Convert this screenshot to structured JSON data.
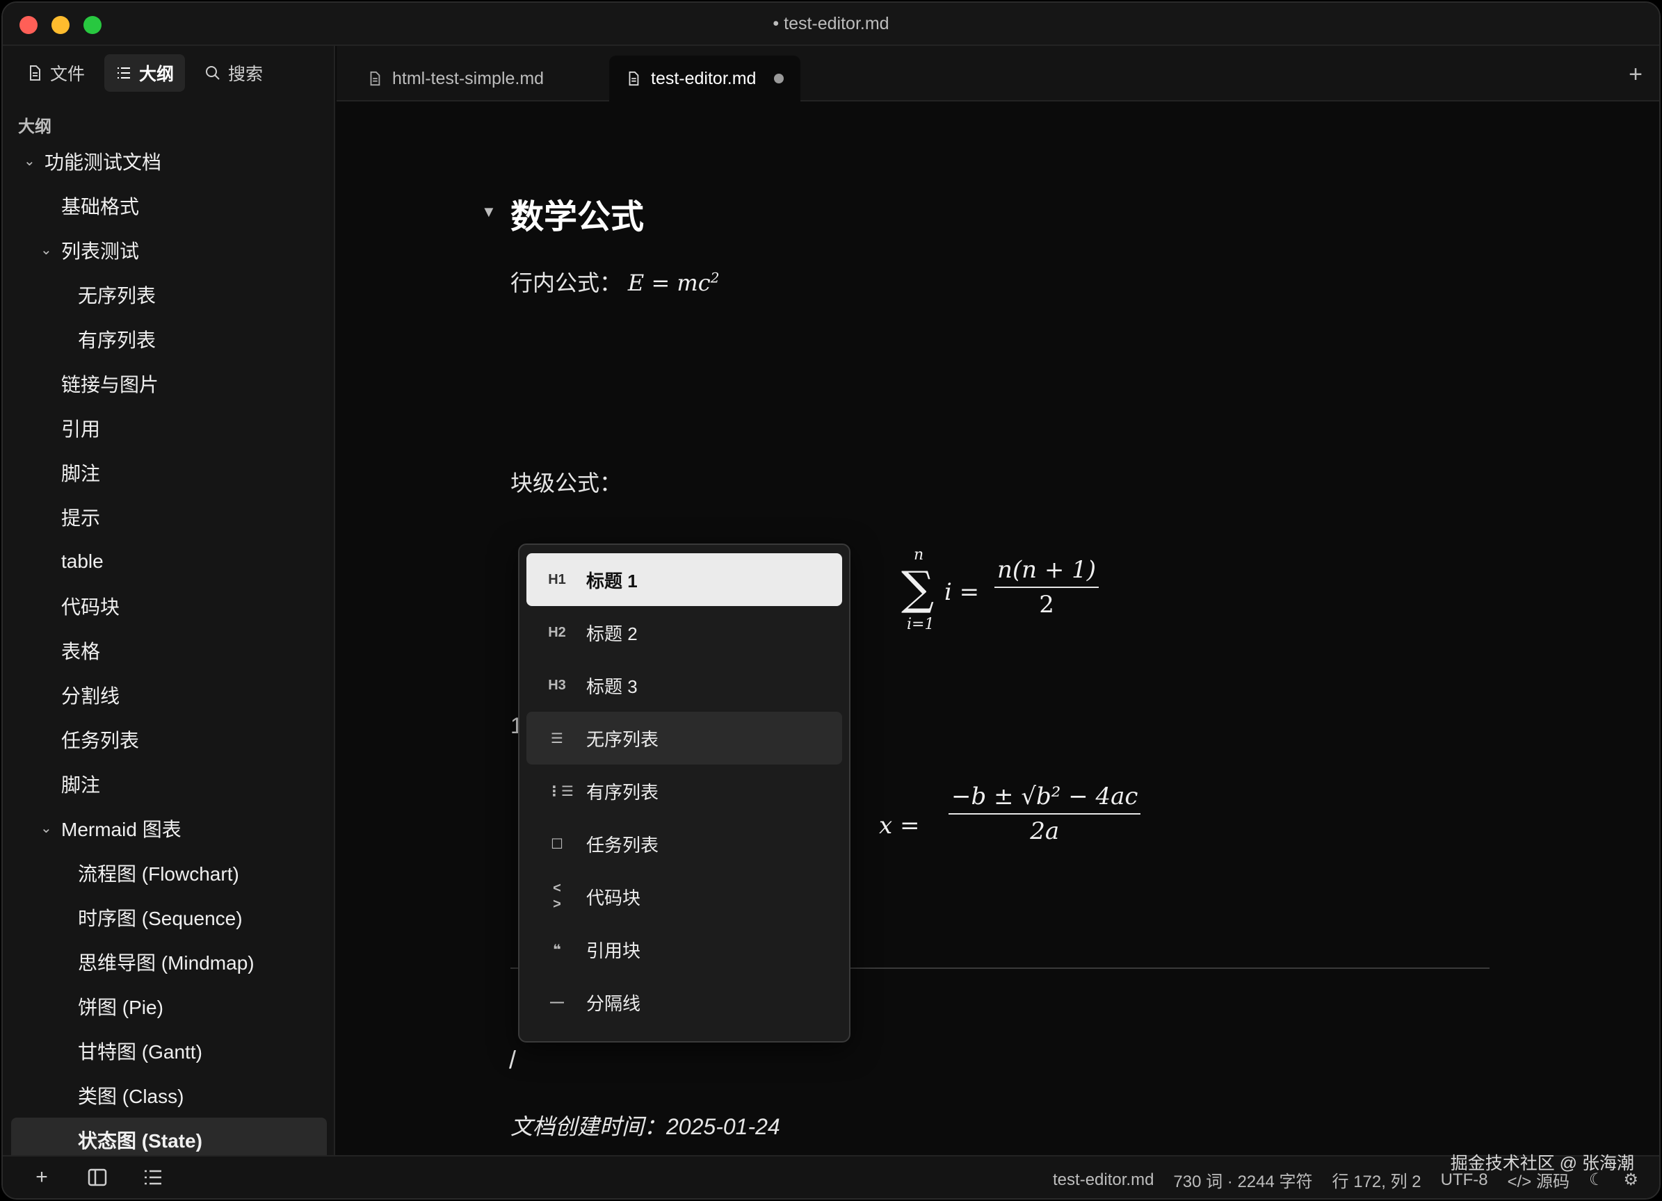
{
  "window": {
    "title": "• test-editor.md"
  },
  "sidebar": {
    "tabs": [
      {
        "label": "文件",
        "icon": "file-icon",
        "active": false
      },
      {
        "label": "大纲",
        "icon": "list-icon",
        "active": true
      },
      {
        "label": "搜索",
        "icon": "search-icon",
        "active": false
      }
    ],
    "outline_header": "大纲",
    "outline": [
      {
        "label": "功能测试文档",
        "level": 1,
        "collapsible": true
      },
      {
        "label": "基础格式",
        "level": 2
      },
      {
        "label": "列表测试",
        "level": 2,
        "collapsible": true
      },
      {
        "label": "无序列表",
        "level": 3
      },
      {
        "label": "有序列表",
        "level": 3
      },
      {
        "label": "链接与图片",
        "level": 2
      },
      {
        "label": "引用",
        "level": 2
      },
      {
        "label": "脚注",
        "level": 2
      },
      {
        "label": "提示",
        "level": 2
      },
      {
        "label": "table",
        "level": 2
      },
      {
        "label": "代码块",
        "level": 2
      },
      {
        "label": "表格",
        "level": 2
      },
      {
        "label": "分割线",
        "level": 2
      },
      {
        "label": "任务列表",
        "level": 2
      },
      {
        "label": "脚注",
        "level": 2
      },
      {
        "label": "Mermaid 图表",
        "level": 2,
        "collapsible": true
      },
      {
        "label": "流程图 (Flowchart)",
        "level": 3
      },
      {
        "label": "时序图 (Sequence)",
        "level": 3
      },
      {
        "label": "思维导图 (Mindmap)",
        "level": 3
      },
      {
        "label": "饼图 (Pie)",
        "level": 3
      },
      {
        "label": "甘特图 (Gantt)",
        "level": 3
      },
      {
        "label": "类图 (Class)",
        "level": 3
      },
      {
        "label": "状态图 (State)",
        "level": 3,
        "selected": true
      }
    ]
  },
  "tabs": [
    {
      "label": "html-test-simple.md",
      "active": false
    },
    {
      "label": "test-editor.md",
      "active": true,
      "dirty": true
    }
  ],
  "editor": {
    "heading": "数学公式",
    "inline_label": "行内公式：",
    "inline_formula": {
      "lhs": "E",
      "eq": "=",
      "rhs": "mc",
      "exp": "2"
    },
    "block_label": "块级公式：",
    "sum_formula": {
      "top": "n",
      "bottom": "i=1",
      "rest": "i =",
      "num": "n(n + 1)",
      "den": "2"
    },
    "quad_formula": {
      "lhs": "x =",
      "num": "−b ± √b² − 4ac",
      "den": "2a"
    },
    "stub_text": "1",
    "slash_text": "/",
    "created": "文档创建时间：2025-01-24"
  },
  "slash_menu": [
    {
      "icon_text": "H1",
      "icon": "heading1-icon",
      "label": "标题 1",
      "state": "selected"
    },
    {
      "icon_text": "H2",
      "icon": "heading2-icon",
      "label": "标题 2",
      "state": ""
    },
    {
      "icon_text": "H3",
      "icon": "heading3-icon",
      "label": "标题 3",
      "state": ""
    },
    {
      "icon_text": "☰",
      "icon": "bullet-list-icon",
      "label": "无序列表",
      "state": "hover"
    },
    {
      "icon_text": "⋮☰",
      "icon": "ordered-list-icon",
      "label": "有序列表",
      "state": ""
    },
    {
      "icon_text": "☐",
      "icon": "task-list-icon",
      "label": "任务列表",
      "state": ""
    },
    {
      "icon_text": "< >",
      "icon": "code-icon",
      "label": "代码块",
      "state": ""
    },
    {
      "icon_text": "❝",
      "icon": "quote-icon",
      "label": "引用块",
      "state": ""
    },
    {
      "icon_text": "—",
      "icon": "divider-icon",
      "label": "分隔线",
      "state": ""
    }
  ],
  "statusbar": {
    "file": "test-editor.md",
    "counts": "730 词 · 2244 字符",
    "cursor": "行 172, 列 2",
    "encoding": "UTF-8",
    "source_label": "源码"
  },
  "watermark": "掘金技术社区 @ 张海潮"
}
